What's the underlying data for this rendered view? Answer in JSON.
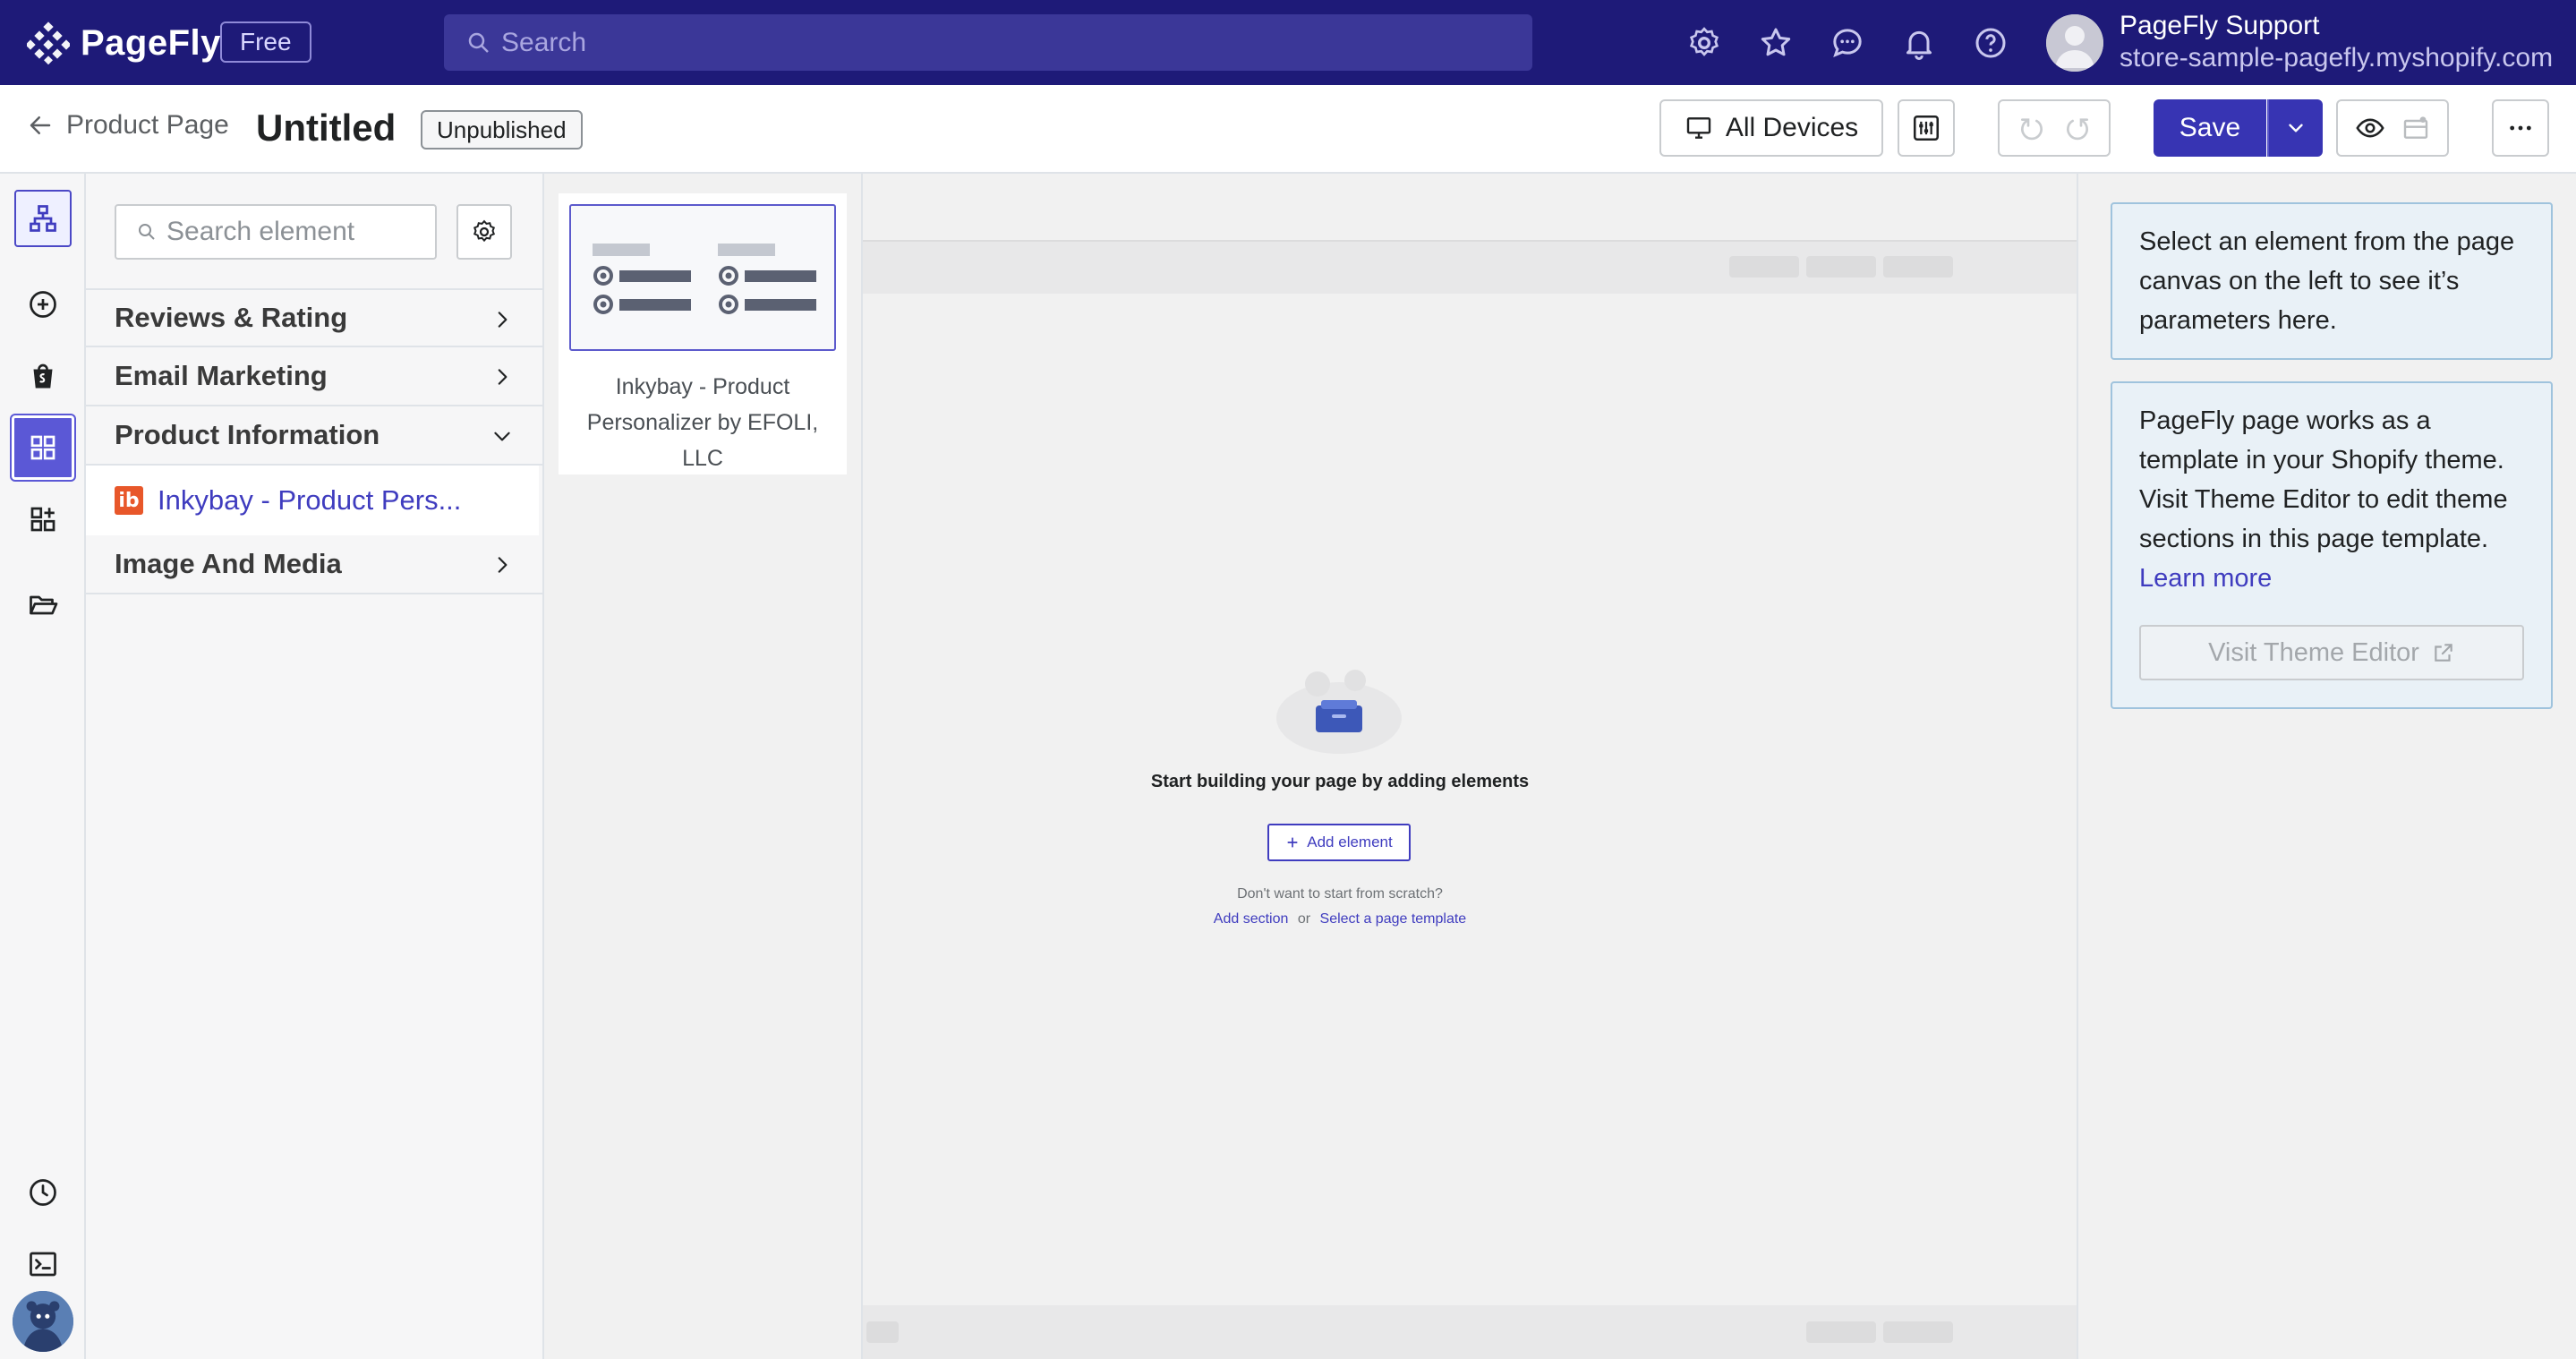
{
  "topbar": {
    "brand": "PageFly",
    "plan": "Free",
    "search_placeholder": "Search",
    "user_name": "PageFly Support",
    "store": "store-sample-pagefly.myshopify.com"
  },
  "toolbar": {
    "back_label": "Product Page",
    "page_title": "Untitled",
    "status": "Unpublished",
    "devices_label": "All Devices",
    "save_label": "Save"
  },
  "element_panel": {
    "search_placeholder": "Search element",
    "categories": [
      {
        "label": "Reviews & Rating",
        "expanded": false
      },
      {
        "label": "Email Marketing",
        "expanded": false
      },
      {
        "label": "Product Information",
        "expanded": true
      },
      {
        "label": "Image And Media",
        "expanded": false
      }
    ],
    "sub_item": "Inkybay - Product Pers..."
  },
  "preview_card": {
    "label": "Inkybay - Product Personalizer by EFOLI, LLC"
  },
  "canvas": {
    "empty_title": "Start building your page by adding elements",
    "add_element": "Add element",
    "no_scratch": "Don't want to start from scratch?",
    "add_section": "Add section",
    "or": "or",
    "select_template": "Select a page template"
  },
  "right_panel": {
    "hint": "Select an element from the page canvas on the left to see it’s parameters here.",
    "theme_info": "PageFly page works as a template in your Shopify theme. Visit Theme Editor to edit theme sections in this page template.",
    "learn_more": "Learn more",
    "visit_theme_editor": "Visit Theme Editor"
  },
  "colors": {
    "topbar": "#1e1a78",
    "accent": "#3734b3",
    "link": "#3f3cbf",
    "info_bg": "#e9f1f7"
  }
}
